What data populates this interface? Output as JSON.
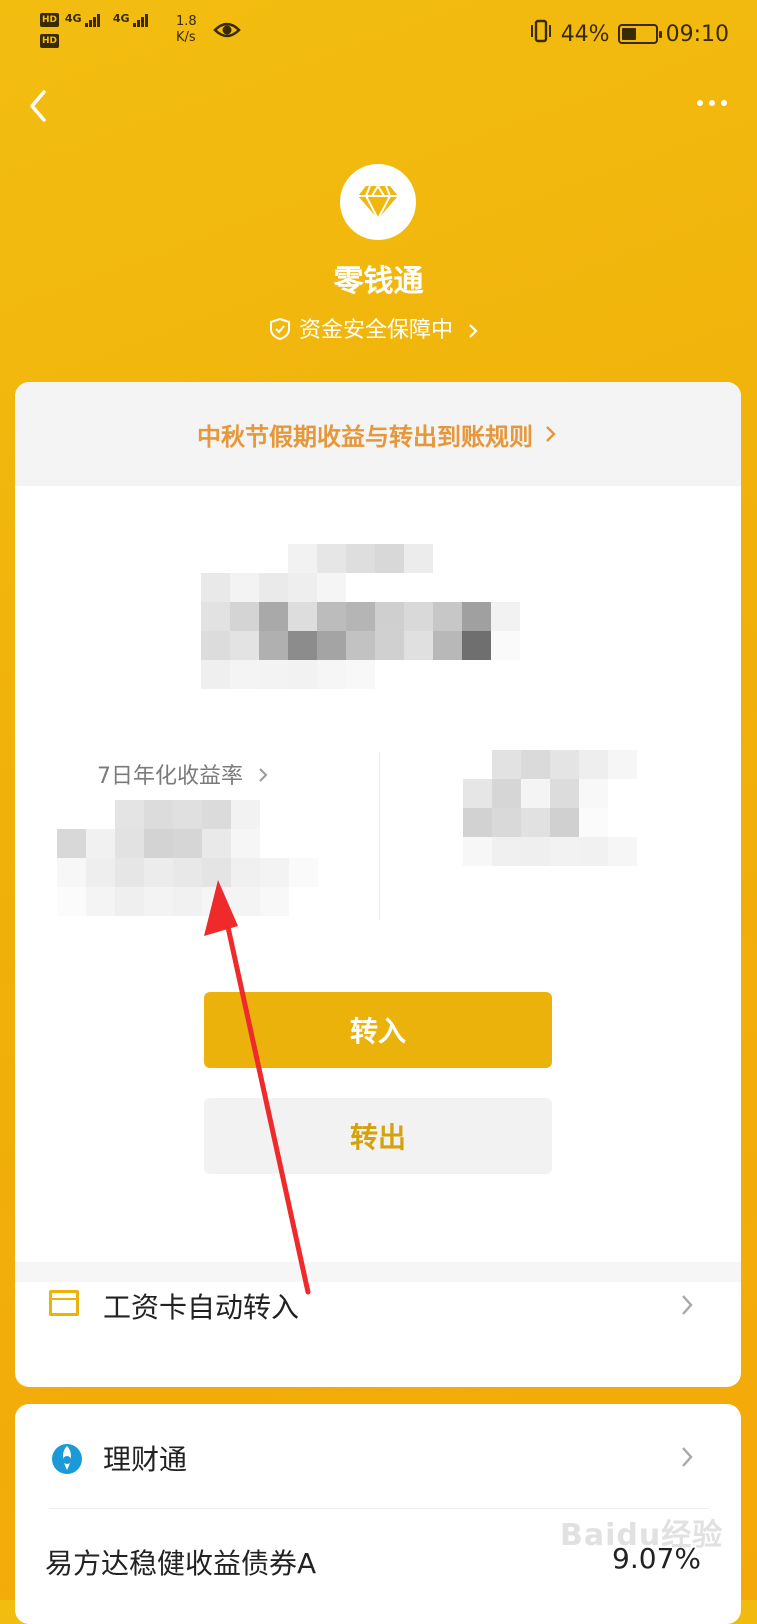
{
  "status_bar": {
    "hd1": "HD",
    "hd2": "HD",
    "net1": "4G",
    "net2": "4G",
    "speed_value": "1.8",
    "speed_unit": "K/s",
    "battery": "44%",
    "battery_level": 0.44,
    "time": "09:10"
  },
  "header": {
    "title": "零钱通",
    "safety_label": "资金安全保障中",
    "logo_icon": "diamond-icon",
    "accent_color": "#f3bd10"
  },
  "card": {
    "notice": "中秋节假期收益与转出到账规则",
    "rate_label": "7日年化收益率",
    "transfer_in": "转入",
    "transfer_out": "转出",
    "salary_label": "工资卡自动转入"
  },
  "card2": {
    "section_label": "理财通",
    "fund_name": "易方达稳健收益债券A",
    "fund_rate": "9.07%"
  },
  "watermark": {
    "text": "Baidu经验"
  }
}
